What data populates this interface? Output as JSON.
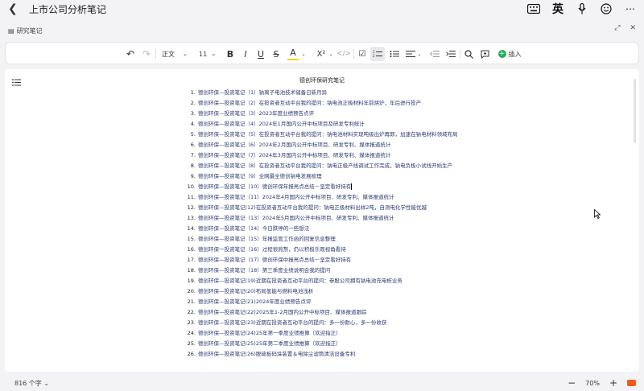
{
  "app": {
    "title": "上市公司分析笔记",
    "tab_name": "研究笔记",
    "ime_label": "英"
  },
  "toolbar": {
    "paragraph_style": "正文",
    "font_size": "11",
    "insert_label": "插入"
  },
  "document": {
    "title": "德创环保研究笔记",
    "items": [
      {
        "num": "1.",
        "text": "德创环保—投资笔记（1）钠离子电池技术储备日新月异"
      },
      {
        "num": "2.",
        "text": "德创环保—投资笔记（2）在投资者互动平台我的提问：钠电池正极材料年前烘炉，年后进行投产"
      },
      {
        "num": "3.",
        "text": "德创环保—投资笔记（3）2023年度业绩预告点评"
      },
      {
        "num": "4.",
        "text": "德创环保—投资笔记（4）2024年1月国内公开中标项目及研发专利统计"
      },
      {
        "num": "5.",
        "text": "德创环保—投资笔记（5）在投资者互动平台我的提问：钠电池材料实现吨级出炉再即，加速在钠电材料领域布局"
      },
      {
        "num": "6.",
        "text": "德创环保—投资笔记（6）2024年2月国内公开中标项目、研发专利、媒体报道统计"
      },
      {
        "num": "7.",
        "text": "德创环保—投资笔记（7）2024年3月国内公开中标项目、研发专利、媒体报道统计"
      },
      {
        "num": "8.",
        "text": "德创环保—投资笔记（8）在投资者互动平台我的提问：钠电正极产线调试工作完成，钠电负极小试线开始生产"
      },
      {
        "num": "9.",
        "text": "德创环保—投资笔记（9）全网最全德创钠电发展梳理"
      },
      {
        "num": "10.",
        "text": "德创环保—投资笔记（10）德创环保年报亮点总结－坚定看好持有"
      },
      {
        "num": "11.",
        "text": "德创环保—投资笔记（11）2024年4月国内公开中标项目、研发专利、媒体报道统计"
      },
      {
        "num": "12.",
        "text": "德创环保—投资笔记(12)在投资者互动平台我的提问：钠电正极材料出样2吨，自测电化学性能优越"
      },
      {
        "num": "13.",
        "text": "德创环保—投资笔记（13）2024年5月国内公开中标项目、研发专利、媒体报道统计"
      },
      {
        "num": "14.",
        "text": "德创环保—投资笔记（14）今日跌停的一些想法"
      },
      {
        "num": "15.",
        "text": "德创环保—投资笔记（15）年报监管工作函的回复信息整理"
      },
      {
        "num": "16.",
        "text": "德创环保一投资笔记（16）过程很煎熬，仍以积极乐观视角看待"
      },
      {
        "num": "17.",
        "text": "德创环保—投资笔记（17）德创环保中报亮点总结－坚定看好持有"
      },
      {
        "num": "18.",
        "text": "德创环保—投资笔记（18）第三季度业绩说明会我的提问"
      },
      {
        "num": "19.",
        "text": "德创环保—投资笔记(19)近期在投资者互动平台的提问：参股公司拥有钠电池充电桩业务"
      },
      {
        "num": "20.",
        "text": "德创环保—投资笔记(20)布局氢能与燃料电池浅析"
      },
      {
        "num": "21.",
        "text": "德创环保—投资笔记(21)2024年度业绩预告点评"
      },
      {
        "num": "22.",
        "text": "德创环保—投资笔记(22)2025年1-2月国内公开中标项目、媒体报道跟踪"
      },
      {
        "num": "23.",
        "text": "德创环保—投资笔记(23)近期在投资者互动平台的提问：多一份耐心，多一份收获"
      },
      {
        "num": "24.",
        "text": "德创环保—投资笔记(24)25年第一季度业绩推算（欢迎指正）"
      },
      {
        "num": "25.",
        "text": "德创环保—投资笔记(25)25年第二季度业绩推算（欢迎指正）"
      },
      {
        "num": "26.",
        "text": "德创环保—投资笔记(26)脱硫板码垛装置＆电除尘滤筒清洁设备专利"
      }
    ]
  },
  "status": {
    "word_count": "816 个字",
    "zoom": "70%"
  }
}
